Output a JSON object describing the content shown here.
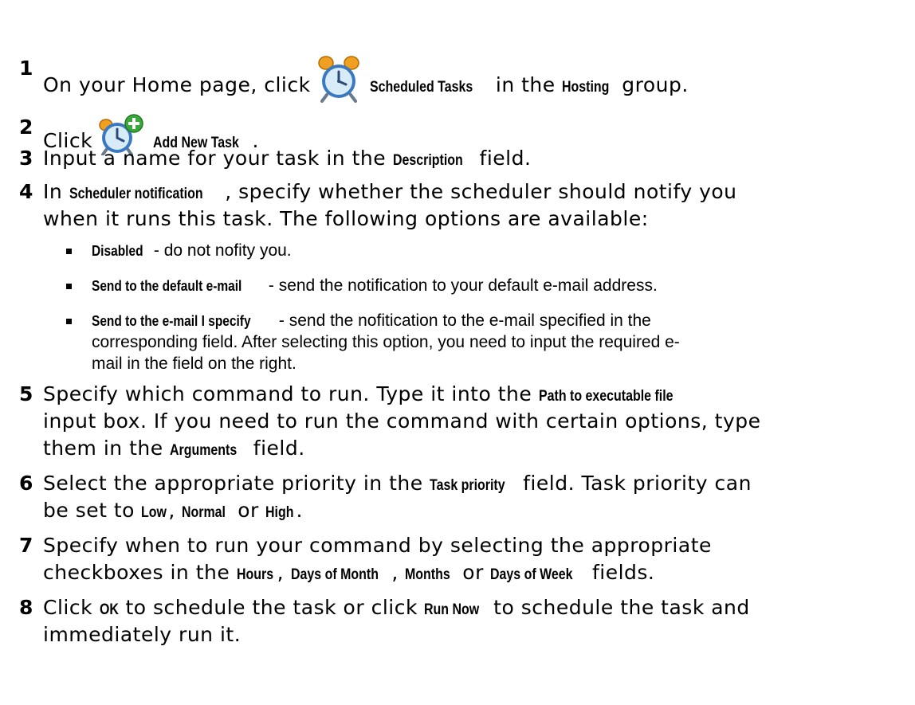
{
  "steps": [
    {
      "number": "1",
      "pre": "On your Home page, click",
      "kw1": "Scheduled Tasks",
      "mid": " in the ",
      "kw2": "Hosting",
      "post": " group."
    },
    {
      "number": "2",
      "pre": "Click",
      "kw1": "Add New Task",
      "post": "."
    },
    {
      "number": "3",
      "pre": "Input a name for your task in the ",
      "kw1": "Description",
      "post": " field."
    },
    {
      "number": "4",
      "pre": "In ",
      "kw1": "Scheduler notification",
      "post": ", specify whether the scheduler should notify you",
      "line2": "when it runs this task. The following options are available:"
    },
    {
      "number": "5",
      "line1_pre": "Specify which command to run. Type it into the ",
      "line1_kw": "Path to executable file",
      "line2": "input box. If you need to run the command with certain options, type",
      "line3_pre": "them in the ",
      "line3_kw": "Arguments",
      "line3_post": " field."
    },
    {
      "number": "6",
      "line1_pre": "Select the appropriate priority in the ",
      "line1_kw": "Task priority",
      "line1_post": " field. Task priority can",
      "line2_pre": "be set to ",
      "kw_low": "Low",
      "sep1": ", ",
      "kw_normal": "Normal",
      "sep2": " or ",
      "kw_high": "High",
      "line2_post": "."
    },
    {
      "number": "7",
      "line1": "Specify when to run your command by selecting the appropriate",
      "line2_pre": "checkboxes in the ",
      "kw_hours": "Hours",
      "sep1": ", ",
      "kw_dom": "Days of Month",
      "sep2": ", ",
      "kw_months": "Months",
      "sep3": " or ",
      "kw_dow": "Days of Week",
      "line2_post": " fields."
    },
    {
      "number": "8",
      "line1_pre": "Click ",
      "kw_ok": "OK",
      "line1_mid": " to schedule the task or click ",
      "kw_run": "Run Now",
      "line1_post": " to schedule the task and",
      "line2": "immediately run it."
    }
  ],
  "bullets": [
    {
      "kw": "Disabled",
      "text": " - do not nofity you."
    },
    {
      "kw": "Send to the default e-mail",
      "text": " - send the notification to your default e-mail address."
    },
    {
      "kw": "Send to the e-mail I specify",
      "text": " - send the nofitication to the e-mail specified in the",
      "line2": "corresponding field. After selecting this option, you need to input the required e-",
      "line3": "mail in the field on the right."
    }
  ],
  "icons": {
    "step1": "alarm-clock-icon",
    "step2": "alarm-clock-add-icon"
  },
  "colors": {
    "clock_bell": "#f0a020",
    "clock_face": "#d8ecf8",
    "clock_rim": "#3a78c0",
    "plus_green": "#3aa83a"
  }
}
